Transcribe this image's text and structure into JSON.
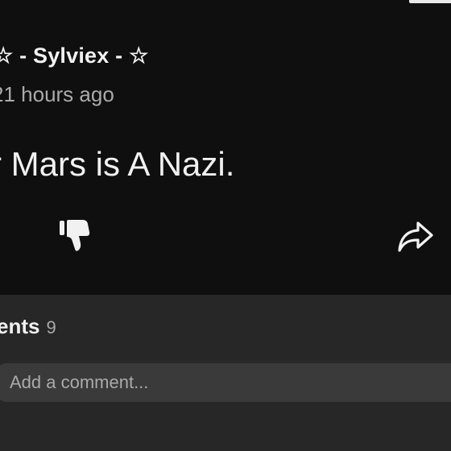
{
  "post": {
    "author": "☆ - Sylviex - ☆",
    "time": "21 hours ago",
    "text": "r Mars is A Nazi."
  },
  "actions": {
    "dislike_icon": "thumbs-down-icon",
    "share_icon": "share-arrow-icon"
  },
  "comments": {
    "title": "ents",
    "count": "9",
    "input_placeholder": "Add a comment..."
  },
  "colors": {
    "background": "#0f0f0f",
    "panel": "#272727",
    "input": "#3a3a3a",
    "text": "#f1f1f1",
    "muted": "#aaaaaa"
  }
}
